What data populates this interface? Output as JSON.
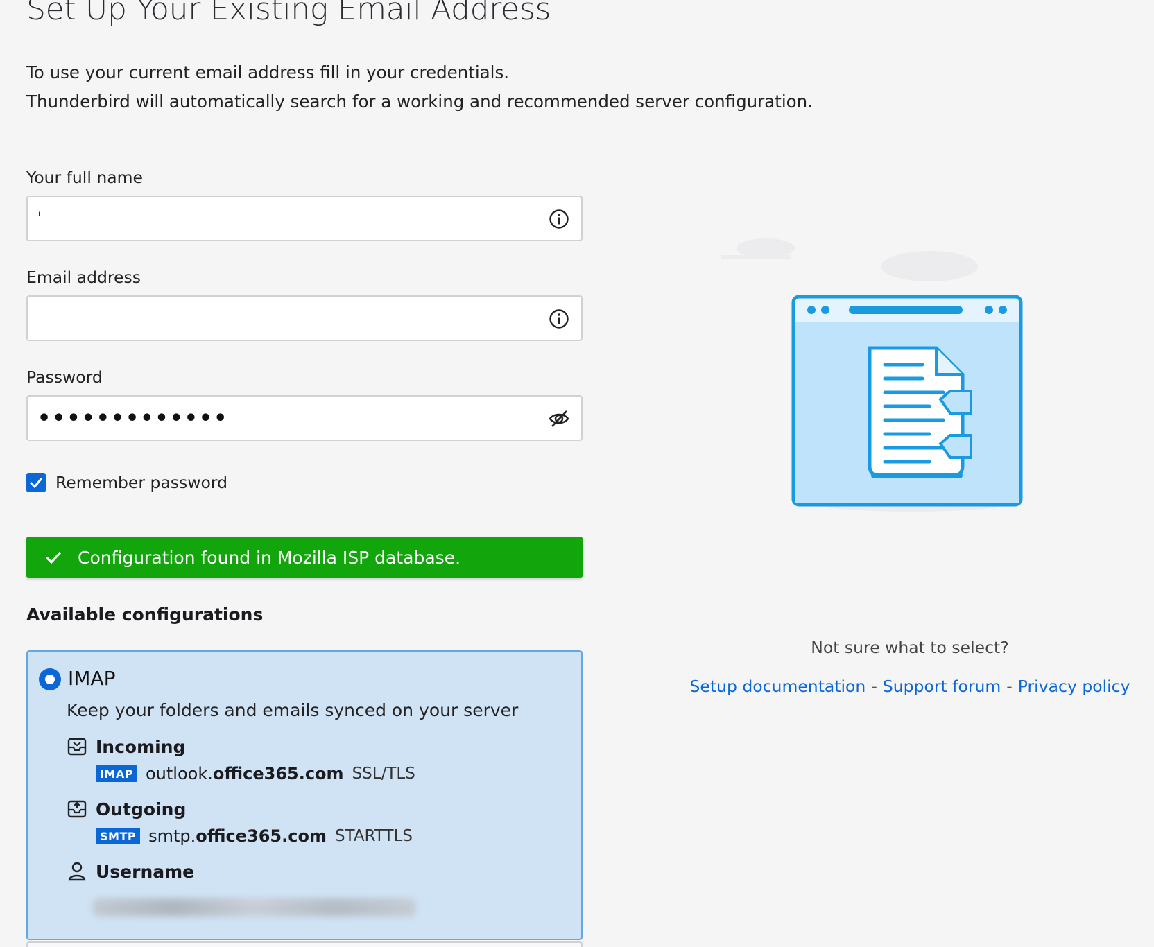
{
  "header": {
    "title": "Set Up Your Existing Email Address",
    "intro_line1": "To use your current email address fill in your credentials.",
    "intro_line2": "Thunderbird will automatically search for a working and recommended server configuration."
  },
  "form": {
    "full_name": {
      "label": "Your full name",
      "value": "'",
      "icon": "info-icon"
    },
    "email": {
      "label": "Email address",
      "value": "",
      "icon": "info-icon"
    },
    "password": {
      "label": "Password",
      "value": "•••••••••••••",
      "icon": "eye-slash-icon"
    },
    "remember": {
      "label": "Remember password",
      "checked": true
    }
  },
  "notice": {
    "text": "Configuration found in Mozilla ISP database.",
    "color": "#12a50c",
    "icon": "checkmark-icon"
  },
  "configurations": {
    "title": "Available configurations",
    "selected": {
      "protocol": "IMAP",
      "description": "Keep your folders and emails synced on your server",
      "incoming": {
        "label": "Incoming",
        "tag": "IMAP",
        "host_prefix": "outlook.",
        "host_domain": "office365.com",
        "security": "SSL/TLS",
        "icon": "inbox-icon"
      },
      "outgoing": {
        "label": "Outgoing",
        "tag": "SMTP",
        "host_prefix": "smtp.",
        "host_domain": "office365.com",
        "security": "STARTTLS",
        "icon": "outbox-icon"
      },
      "username": {
        "label": "Username",
        "icon": "user-icon"
      }
    }
  },
  "help": {
    "question": "Not sure what to select?",
    "links": [
      "Setup documentation",
      "Support forum",
      "Privacy policy"
    ],
    "separator": "-"
  },
  "colors": {
    "accent": "#0b67d6",
    "card_bg": "#d0e3f5",
    "card_border": "#63a7e6",
    "success": "#12a50c"
  }
}
